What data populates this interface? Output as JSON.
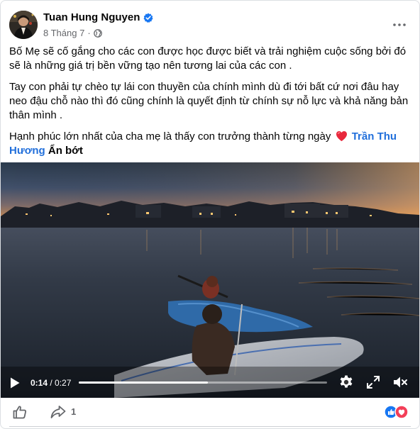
{
  "post": {
    "author": "Tuan Hung Nguyen",
    "date": "8 Tháng 7",
    "separator": "·",
    "paragraphs": [
      "Bố Mẹ sẽ cố gắng cho các con được học được biết và trải nghiệm cuộc sống bởi đó sẽ là những giá trị bền vững tạo nên tương lai của các con .",
      "Tay con phải tự chèo tự lái con thuyền của chính mình dù đi tới bất cứ nơi đâu hay neo đậu chỗ nào thì đó cũng chính là quyết định từ chính sự nỗ lực và khả năng bản thân mình ."
    ],
    "last_paragraph": "Hạnh phúc lớn nhất của cha mẹ là thấy con trưởng thành từng ngày",
    "mention": "Trần Thu Hương",
    "see_less": "Ẩn bớt"
  },
  "video": {
    "current_time": "0:14",
    "time_separator": " / ",
    "duration": "0:27",
    "progress": 0.52
  },
  "footer": {
    "share_count": "1"
  },
  "colors": {
    "link": "#216fdb",
    "verified": "#1877f2",
    "like": "#1877f2",
    "love": "#f33e58"
  },
  "icons": {
    "verified": "verified-badge-icon",
    "globe": "globe-icon",
    "more": "more-options-icon",
    "heart": "red-heart-icon",
    "play": "play-icon",
    "settings": "gear-icon",
    "fullscreen": "fullscreen-icon",
    "mute": "muted-speaker-icon",
    "like": "thumbs-up-icon",
    "share": "share-icon"
  }
}
